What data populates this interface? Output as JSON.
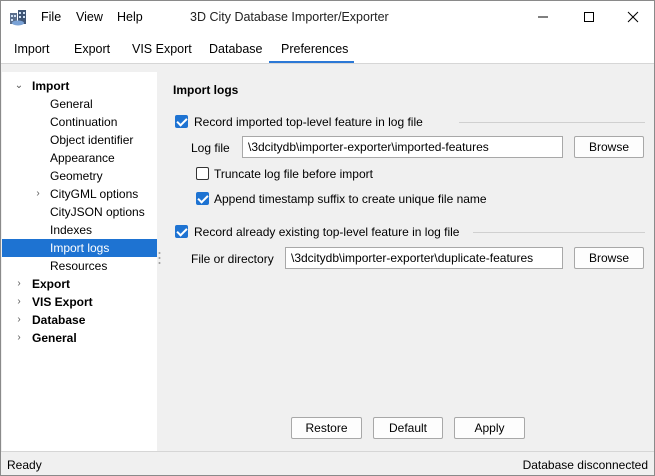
{
  "window": {
    "title": "3D City Database Importer/Exporter",
    "menu": [
      "File",
      "View",
      "Help"
    ]
  },
  "tabs": [
    {
      "label": "Import"
    },
    {
      "label": "Export"
    },
    {
      "label": "VIS Export"
    },
    {
      "label": "Database"
    },
    {
      "label": "Preferences",
      "active": true
    }
  ],
  "tree": {
    "items": [
      {
        "label": "Import",
        "bold": true,
        "expanded": true
      },
      {
        "label": "General"
      },
      {
        "label": "Continuation"
      },
      {
        "label": "Object identifier"
      },
      {
        "label": "Appearance"
      },
      {
        "label": "Geometry"
      },
      {
        "label": "CityGML options",
        "collapsed": true
      },
      {
        "label": "CityJSON options"
      },
      {
        "label": "Indexes"
      },
      {
        "label": "Import logs",
        "selected": true
      },
      {
        "label": "Resources"
      },
      {
        "label": "Export",
        "bold": true,
        "collapsed": true
      },
      {
        "label": "VIS Export",
        "bold": true,
        "collapsed": true
      },
      {
        "label": "Database",
        "bold": true,
        "collapsed": true
      },
      {
        "label": "General",
        "bold": true,
        "collapsed": true
      }
    ]
  },
  "panel": {
    "title": "Import logs",
    "group1": {
      "checkbox_label": "Record imported top-level feature in log file",
      "checked": true,
      "field_label": "Log file",
      "field_value": "\\3dcitydb\\importer-exporter\\imported-features",
      "browse_label": "Browse",
      "truncate_label": "Truncate log file before import",
      "truncate_checked": false,
      "timestamp_label": "Append timestamp suffix to create unique file name",
      "timestamp_checked": true
    },
    "group2": {
      "checkbox_label": "Record already existing top-level feature in log file",
      "checked": true,
      "field_label": "File or directory",
      "field_value": "\\3dcitydb\\importer-exporter\\duplicate-features",
      "browse_label": "Browse"
    },
    "buttons": {
      "restore": "Restore",
      "default": "Default",
      "apply": "Apply"
    }
  },
  "status": {
    "left": "Ready",
    "right": "Database disconnected"
  },
  "colors": {
    "accent": "#1e73d2",
    "tab_underline": "#2b78d6"
  }
}
